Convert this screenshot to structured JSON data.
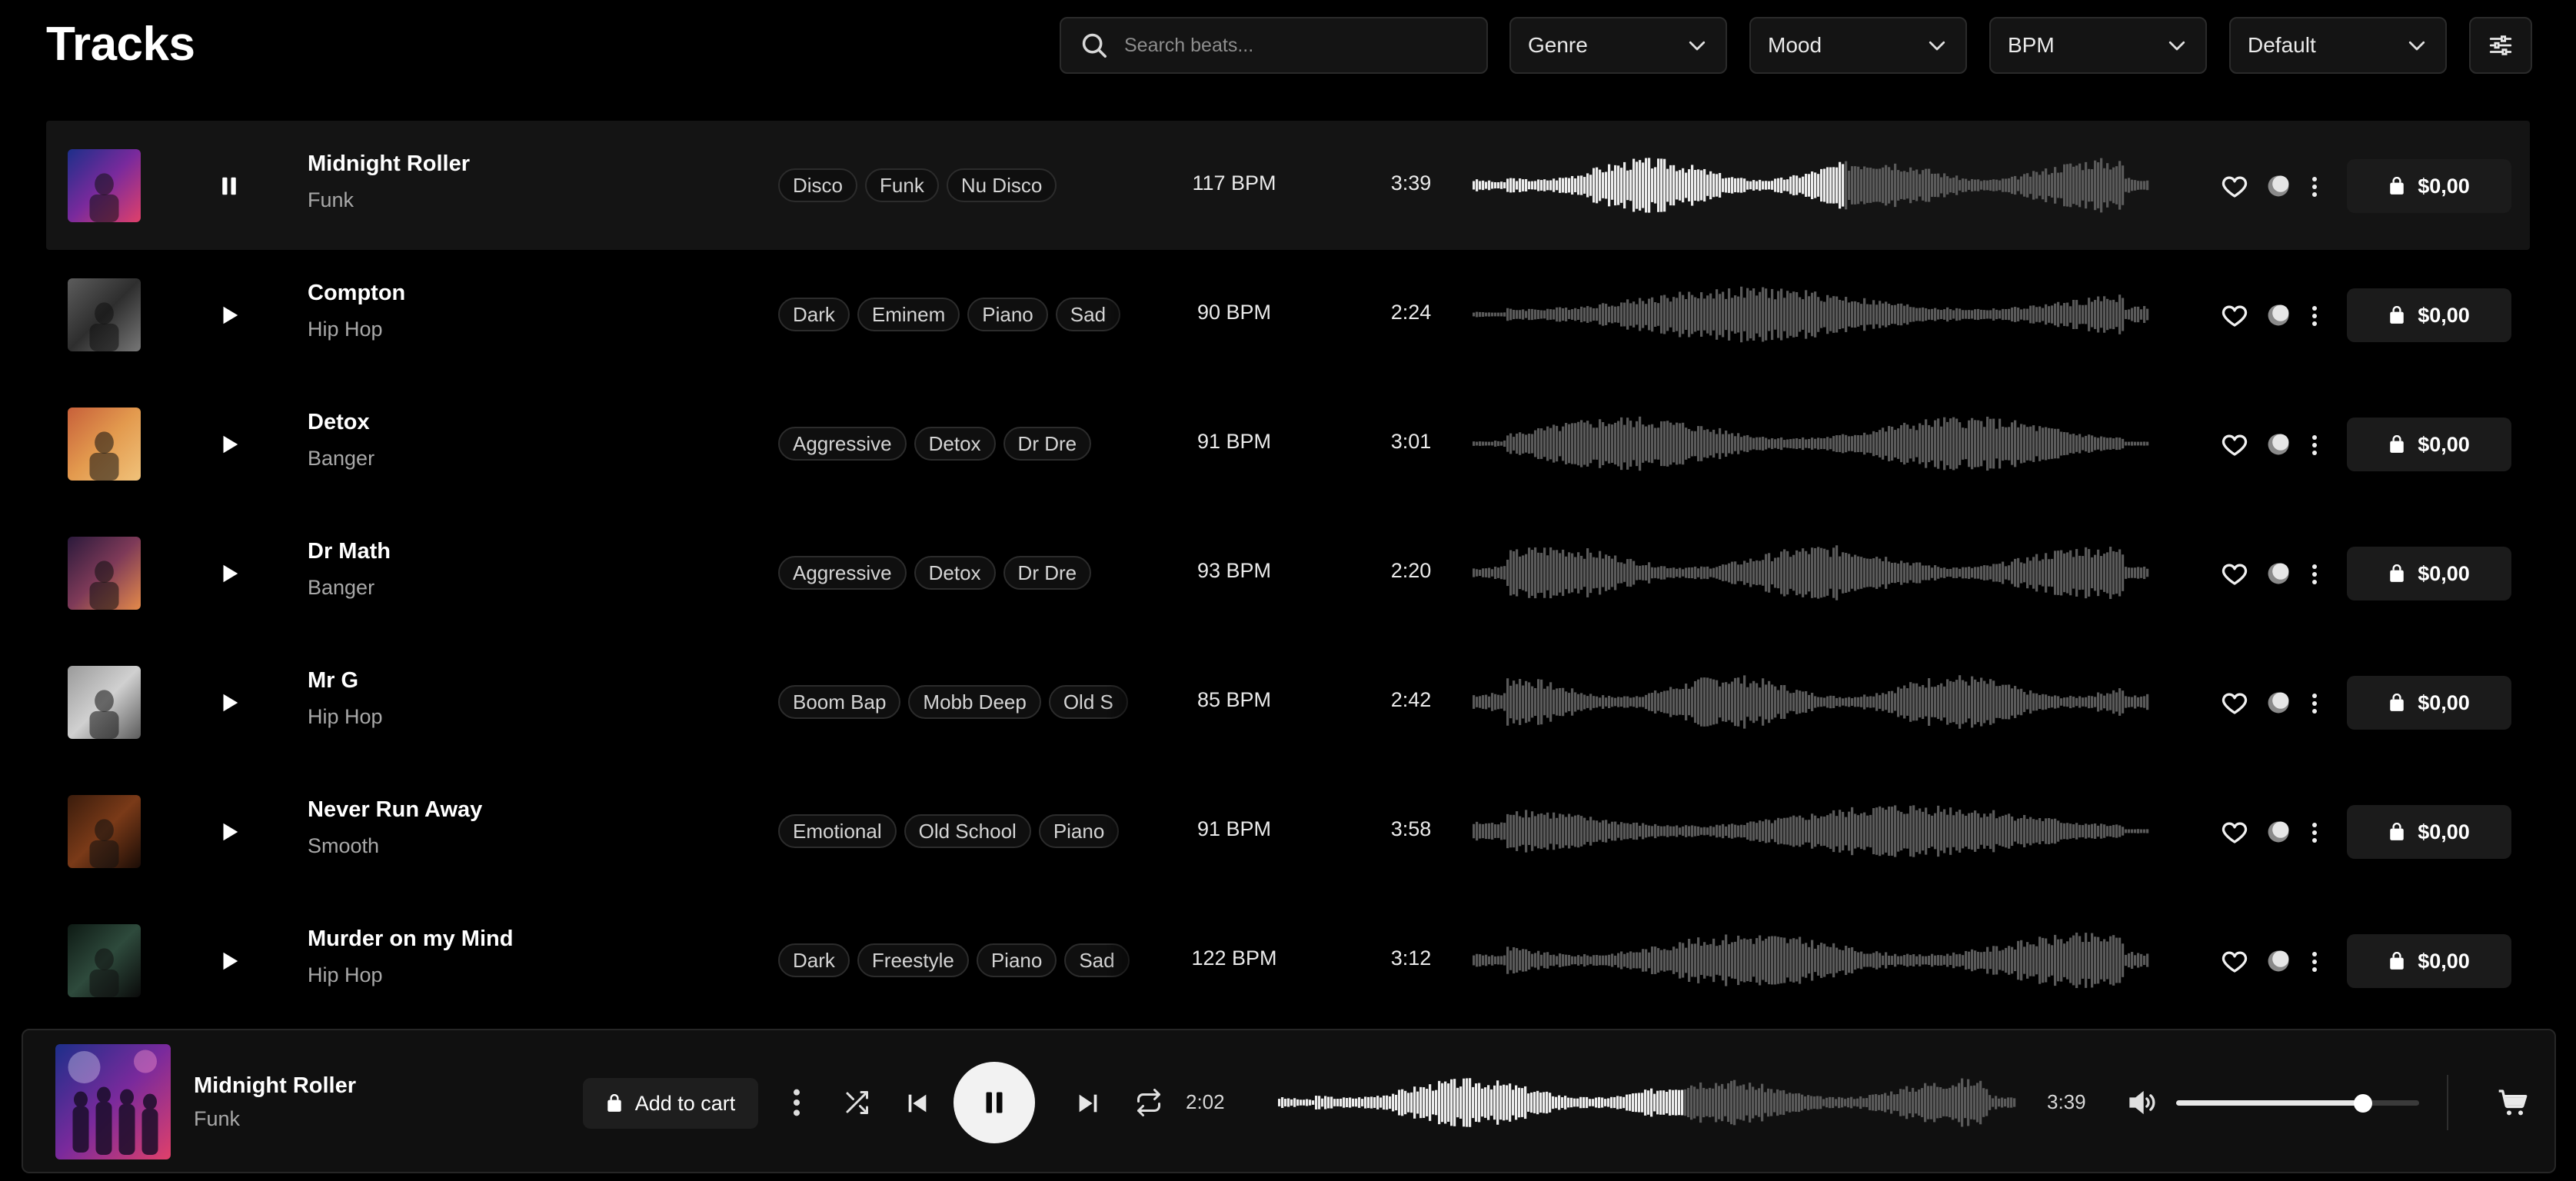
{
  "header": {
    "title": "Tracks",
    "search_placeholder": "Search beats...",
    "filters": [
      {
        "label": "Genre"
      },
      {
        "label": "Mood"
      },
      {
        "label": "BPM"
      },
      {
        "label": "Default"
      }
    ]
  },
  "tracks": [
    {
      "title": "Midnight Roller",
      "genre": "Funk",
      "tags": [
        "Disco",
        "Funk",
        "Nu Disco"
      ],
      "bpm": "117 BPM",
      "duration": "3:39",
      "price": "$0,00",
      "playing": true,
      "progress": 0.55
    },
    {
      "title": "Compton",
      "genre": "Hip Hop",
      "tags": [
        "Dark",
        "Eminem",
        "Piano",
        "Sad"
      ],
      "bpm": "90 BPM",
      "duration": "2:24",
      "price": "$0,00",
      "playing": false,
      "progress": 0
    },
    {
      "title": "Detox",
      "genre": "Banger",
      "tags": [
        "Aggressive",
        "Detox",
        "Dr Dre"
      ],
      "bpm": "91 BPM",
      "duration": "3:01",
      "price": "$0,00",
      "playing": false,
      "progress": 0
    },
    {
      "title": "Dr Math",
      "genre": "Banger",
      "tags": [
        "Aggressive",
        "Detox",
        "Dr Dre"
      ],
      "bpm": "93 BPM",
      "duration": "2:20",
      "price": "$0,00",
      "playing": false,
      "progress": 0
    },
    {
      "title": "Mr G",
      "genre": "Hip Hop",
      "tags": [
        "Boom Bap",
        "Mobb Deep",
        "Old S"
      ],
      "bpm": "85 BPM",
      "duration": "2:42",
      "price": "$0,00",
      "playing": false,
      "progress": 0
    },
    {
      "title": "Never Run Away",
      "genre": "Smooth",
      "tags": [
        "Emotional",
        "Old School",
        "Piano"
      ],
      "bpm": "91 BPM",
      "duration": "3:58",
      "price": "$0,00",
      "playing": false,
      "progress": 0
    },
    {
      "title": "Murder on my Mind",
      "genre": "Hip Hop",
      "tags": [
        "Dark",
        "Freestyle",
        "Piano",
        "Sad"
      ],
      "bpm": "122 BPM",
      "duration": "3:12",
      "price": "$0,00",
      "playing": false,
      "progress": 0
    }
  ],
  "player": {
    "title": "Midnight Roller",
    "genre": "Funk",
    "add_to_cart_label": "Add to cart",
    "current_time": "2:02",
    "total_time": "3:39",
    "progress": 0.55,
    "volume": 0.77
  },
  "colors": {
    "background": "#000000",
    "active_row": "#141414",
    "waveform_played": "#ededed",
    "waveform_unplayed": "#5a5a5a"
  },
  "icons": {
    "search": "search-icon",
    "chevron": "chevron-down-icon",
    "filter": "sliders-icon",
    "play": "play-icon",
    "pause": "pause-icon",
    "like": "heart-icon",
    "disc": "disc-icon",
    "more": "more-vertical-icon",
    "bag": "shopping-bag-icon",
    "shuffle": "shuffle-icon",
    "previous": "skip-back-icon",
    "next": "skip-forward-icon",
    "repeat": "repeat-icon",
    "volume": "volume-icon",
    "cart": "cart-icon"
  }
}
